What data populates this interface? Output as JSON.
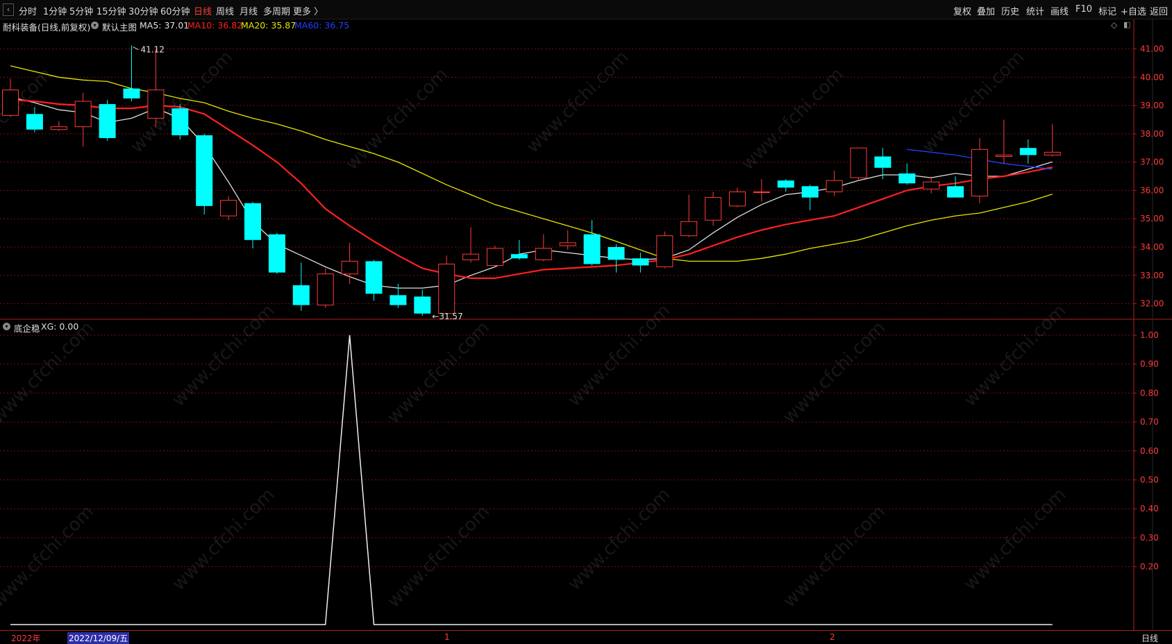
{
  "toolbar": {
    "back_icon": "‹",
    "tabs": [
      "分时",
      "1分钟",
      "5分钟",
      "15分钟",
      "30分钟",
      "60分钟",
      "日线",
      "周线",
      "月线",
      "多周期",
      "更多 〉"
    ],
    "active_tab": "日线",
    "right_tools": [
      "复权",
      "叠加",
      "历史",
      "统计",
      "画线",
      "F10",
      "标记",
      "+自选",
      "返回"
    ]
  },
  "stock": {
    "title": "耐科装备(日线,前复权)",
    "main_chart_name": "默认主图",
    "ma5_label": "MA5: 37.01",
    "ma10_label": "MA10: 36.82",
    "ma20_label": "MA20: 35.87",
    "ma60_label": "MA60: 36.75"
  },
  "indicator": {
    "name": "底企稳",
    "xg_label": "XG: 0.00"
  },
  "colors": {
    "up": "#ff3b3b",
    "down": "#00ffff",
    "ma5": "#e0e0e0",
    "ma10": "#ff2020",
    "ma20": "#e8e800",
    "ma60": "#2040ff",
    "grid": "#7a1010",
    "axis_border": "#b02020"
  },
  "bottom": {
    "year_label": "2022年",
    "cursor_date": "2022/12/09/五",
    "month_1": "1",
    "month_2": "2",
    "period": "日线"
  },
  "watermark": "www.cfchi.com",
  "chart_data": [
    {
      "type": "candlestick",
      "price_axis": [
        41.0,
        40.0,
        39.0,
        38.0,
        37.0,
        36.0,
        35.0,
        34.0,
        33.0,
        32.0
      ],
      "ylim": [
        31.45,
        41.6
      ],
      "annotations": {
        "high": "41.12",
        "low": "31.57"
      },
      "grid": true,
      "candles": [
        {
          "o": 38.65,
          "c": 39.55,
          "h": 39.95,
          "l": 38.6
        },
        {
          "o": 38.7,
          "c": 38.15,
          "h": 38.95,
          "l": 38.05
        },
        {
          "o": 38.15,
          "c": 38.25,
          "h": 38.45,
          "l": 38.1
        },
        {
          "o": 38.25,
          "c": 39.15,
          "h": 39.45,
          "l": 37.55
        },
        {
          "o": 39.05,
          "c": 37.85,
          "h": 39.2,
          "l": 37.75
        },
        {
          "o": 39.6,
          "c": 39.25,
          "h": 41.12,
          "l": 39.15
        },
        {
          "o": 38.55,
          "c": 39.55,
          "h": 41.0,
          "l": 38.25
        },
        {
          "o": 38.9,
          "c": 37.95,
          "h": 39.05,
          "l": 37.8
        },
        {
          "o": 37.95,
          "c": 35.45,
          "h": 38.0,
          "l": 35.15
        },
        {
          "o": 35.1,
          "c": 35.65,
          "h": 35.8,
          "l": 34.95
        },
        {
          "o": 35.55,
          "c": 34.25,
          "h": 35.6,
          "l": 33.95
        },
        {
          "o": 34.45,
          "c": 33.1,
          "h": 34.5,
          "l": 33.05
        },
        {
          "o": 32.65,
          "c": 31.95,
          "h": 33.45,
          "l": 31.75
        },
        {
          "o": 31.95,
          "c": 33.05,
          "h": 33.25,
          "l": 31.85
        },
        {
          "o": 33.05,
          "c": 33.5,
          "h": 34.15,
          "l": 32.7
        },
        {
          "o": 33.5,
          "c": 32.35,
          "h": 33.55,
          "l": 32.1
        },
        {
          "o": 32.3,
          "c": 31.95,
          "h": 32.7,
          "l": 31.85
        },
        {
          "o": 32.25,
          "c": 31.65,
          "h": 32.5,
          "l": 31.57
        },
        {
          "o": 31.65,
          "c": 33.4,
          "h": 33.7,
          "l": 31.6
        },
        {
          "o": 33.55,
          "c": 33.75,
          "h": 34.7,
          "l": 33.45
        },
        {
          "o": 33.35,
          "c": 33.95,
          "h": 34.05,
          "l": 33.3
        },
        {
          "o": 33.75,
          "c": 33.6,
          "h": 34.25,
          "l": 33.55
        },
        {
          "o": 33.55,
          "c": 33.95,
          "h": 34.45,
          "l": 33.5
        },
        {
          "o": 34.05,
          "c": 34.15,
          "h": 34.6,
          "l": 33.9
        },
        {
          "o": 34.45,
          "c": 33.4,
          "h": 34.95,
          "l": 33.35
        },
        {
          "o": 34.0,
          "c": 33.55,
          "h": 34.1,
          "l": 33.1
        },
        {
          "o": 33.6,
          "c": 33.35,
          "h": 33.8,
          "l": 33.1
        },
        {
          "o": 33.3,
          "c": 34.4,
          "h": 34.55,
          "l": 33.25
        },
        {
          "o": 34.4,
          "c": 34.9,
          "h": 35.85,
          "l": 34.35
        },
        {
          "o": 34.95,
          "c": 35.75,
          "h": 35.95,
          "l": 34.75
        },
        {
          "o": 35.45,
          "c": 35.95,
          "h": 36.1,
          "l": 35.4
        },
        {
          "o": 35.95,
          "c": 35.95,
          "h": 36.4,
          "l": 35.6
        },
        {
          "o": 36.35,
          "c": 36.1,
          "h": 36.4,
          "l": 35.95
        },
        {
          "o": 36.15,
          "c": 35.75,
          "h": 36.2,
          "l": 35.3
        },
        {
          "o": 35.95,
          "c": 36.35,
          "h": 36.7,
          "l": 35.8
        },
        {
          "o": 36.45,
          "c": 37.5,
          "h": 37.5,
          "l": 36.35
        },
        {
          "o": 37.2,
          "c": 36.8,
          "h": 37.5,
          "l": 36.4
        },
        {
          "o": 36.6,
          "c": 36.25,
          "h": 36.95,
          "l": 36.2
        },
        {
          "o": 36.05,
          "c": 36.3,
          "h": 36.5,
          "l": 35.9
        },
        {
          "o": 36.15,
          "c": 35.75,
          "h": 36.5,
          "l": 35.75
        },
        {
          "o": 35.8,
          "c": 37.45,
          "h": 37.85,
          "l": 35.55
        },
        {
          "o": 37.2,
          "c": 37.25,
          "h": 38.5,
          "l": 36.95
        },
        {
          "o": 37.5,
          "c": 37.25,
          "h": 37.8,
          "l": 36.95
        },
        {
          "o": 37.25,
          "c": 37.35,
          "h": 38.35,
          "l": 37.2
        }
      ],
      "series": [
        {
          "name": "MA5",
          "values": [
            39.3,
            39.1,
            38.85,
            38.75,
            38.4,
            38.55,
            38.9,
            38.55,
            37.6,
            36.3,
            34.9,
            34.1,
            33.7,
            33.3,
            32.95,
            32.65,
            32.55,
            32.55,
            32.65,
            33.0,
            33.3,
            33.75,
            33.9,
            33.8,
            33.7,
            33.6,
            33.55,
            33.6,
            33.9,
            34.5,
            35.05,
            35.5,
            35.85,
            35.95,
            36.1,
            36.35,
            36.55,
            36.55,
            36.45,
            36.6,
            36.5,
            36.5,
            36.75,
            37.01
          ]
        },
        {
          "name": "MA10",
          "values": [
            39.2,
            39.15,
            39.05,
            39.0,
            38.9,
            38.9,
            39.0,
            38.95,
            38.7,
            38.15,
            37.6,
            37.0,
            36.25,
            35.35,
            34.75,
            34.2,
            33.7,
            33.25,
            33.05,
            32.9,
            32.9,
            33.05,
            33.2,
            33.25,
            33.3,
            33.35,
            33.45,
            33.55,
            33.75,
            34.05,
            34.35,
            34.6,
            34.8,
            34.95,
            35.1,
            35.4,
            35.7,
            36.0,
            36.15,
            36.25,
            36.4,
            36.5,
            36.65,
            36.82
          ]
        },
        {
          "name": "MA20",
          "values": [
            40.4,
            40.2,
            40.0,
            39.9,
            39.85,
            39.6,
            39.45,
            39.25,
            39.1,
            38.8,
            38.55,
            38.35,
            38.1,
            37.8,
            37.55,
            37.3,
            37.0,
            36.6,
            36.2,
            35.85,
            35.5,
            35.25,
            35.0,
            34.75,
            34.5,
            34.2,
            33.9,
            33.6,
            33.5,
            33.5,
            33.5,
            33.6,
            33.75,
            33.95,
            34.1,
            34.25,
            34.5,
            34.75,
            34.95,
            35.1,
            35.2,
            35.4,
            35.6,
            35.87
          ]
        },
        {
          "name": "MA60",
          "values": [
            null,
            null,
            null,
            null,
            null,
            null,
            null,
            null,
            null,
            null,
            null,
            null,
            null,
            null,
            null,
            null,
            null,
            null,
            null,
            null,
            null,
            null,
            null,
            null,
            null,
            null,
            null,
            null,
            null,
            null,
            null,
            null,
            null,
            null,
            null,
            null,
            null,
            37.45,
            37.35,
            37.25,
            37.1,
            36.95,
            36.85,
            36.75
          ]
        }
      ]
    },
    {
      "type": "line",
      "name": "XG",
      "ylim": [
        0,
        1.0
      ],
      "y_ticks": [
        1.0,
        0.9,
        0.8,
        0.7,
        0.6,
        0.5,
        0.4,
        0.3,
        0.2
      ],
      "x_range": [
        0,
        43
      ],
      "values": [
        0,
        0,
        0,
        0,
        0,
        0,
        0,
        0,
        0,
        0,
        0,
        0,
        0,
        0,
        1,
        0,
        0,
        0,
        0,
        0,
        0,
        0,
        0,
        0,
        0,
        0,
        0,
        0,
        0,
        0,
        0,
        0,
        0,
        0,
        0,
        0,
        0,
        0,
        0,
        0,
        0,
        0,
        0,
        0
      ]
    }
  ]
}
